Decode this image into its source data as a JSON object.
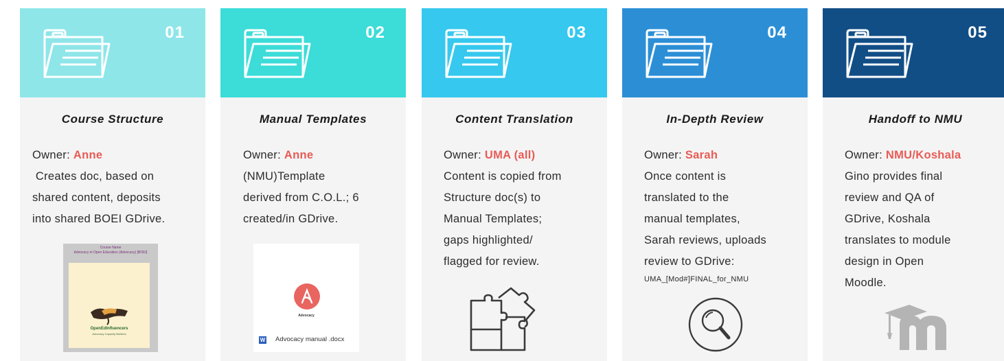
{
  "cards": [
    {
      "number": "01",
      "color": "#8ee6e9",
      "title": "Course Structure",
      "owner_label": "Owner:",
      "owner_name": "Anne",
      "lines": [
        " Creates doc, based on",
        "shared content, deposits",
        "into shared BOEI GDrive."
      ],
      "thumbnail": {
        "title_line1": "Course Name",
        "title_line2": "Advocacy in Open Education (Advocacy) [BOEI]",
        "caption": "OpenEdInfluencers",
        "subcaption": "Advocacy Capacity Builders"
      }
    },
    {
      "number": "02",
      "color": "#3cdcd8",
      "title": "Manual Templates",
      "owner_label": "Owner:",
      "owner_name": "Anne",
      "lines": [
        "(NMU)Template",
        "derived from C.O.L.; 6",
        "created/in GDrive."
      ],
      "thumbnail": {
        "caption": "Advocacy",
        "file_icon": "W",
        "file_name": "Advocacy manual .docx"
      }
    },
    {
      "number": "03",
      "color": "#36c8ee",
      "title": "Content Translation",
      "owner_label": "Owner:",
      "owner_name": "UMA (all)",
      "lines": [
        "Content is copied from",
        "Structure doc(s) to",
        "Manual Templates;",
        "gaps highlighted/",
        "flagged for review."
      ],
      "icon": "puzzle-icon"
    },
    {
      "number": "04",
      "color": "#2c8fd6",
      "title": "In-Depth Review",
      "owner_label": "Owner:",
      "owner_name": "Sarah",
      "lines": [
        "Once content is",
        "translated to the",
        "manual templates,",
        "Sarah reviews, uploads",
        "review to GDrive:"
      ],
      "small_line": "UMA_[Mod#]FINAL_for_NMU",
      "icon": "magnifier-icon"
    },
    {
      "number": "05",
      "color": "#124e86",
      "title": "Handoff to NMU",
      "owner_label": "Owner:",
      "owner_name": "NMU/Koshala",
      "lines": [
        "Gino provides final",
        "review and QA of",
        "GDrive, Koshala",
        "translates to module",
        "design in Open",
        "Moodle."
      ],
      "icon": "moodle-logo-icon"
    }
  ]
}
